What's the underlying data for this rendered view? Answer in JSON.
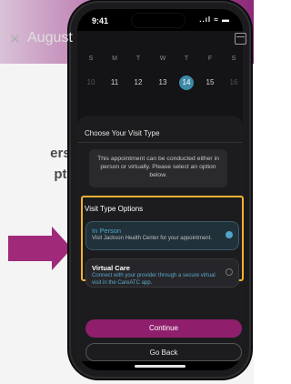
{
  "background": {
    "side_text_line1": "erson",
    "side_text_line2": "ption",
    "side_text_dot": "."
  },
  "status_bar": {
    "time": "9:41",
    "system_icons": "..ıl ≈ ▬"
  },
  "calendar": {
    "month": "August",
    "weekdays": [
      "S",
      "M",
      "T",
      "W",
      "T",
      "F",
      "S"
    ],
    "days": [
      "10",
      "11",
      "12",
      "13",
      "14",
      "15",
      "16"
    ],
    "selected_day": "14"
  },
  "sheet": {
    "title": "Choose Your Visit Type",
    "info_text": "This appointment can be conducted either in person or virtually. Please select an option below.",
    "options_heading": "Visit Type Options",
    "options": [
      {
        "title": "In Person",
        "description": "Visit Jackson Health Center for your appointment.",
        "selected": true
      },
      {
        "title": "Virtual Care",
        "description": "Connect with your provider through a secure virtual visit in the CareATC app.",
        "selected": false
      }
    ],
    "continue_label": "Continue",
    "back_label": "Go Back"
  },
  "colors": {
    "accent_magenta": "#a02a79",
    "highlight_gold": "#f2b233",
    "selected_teal": "#4fa6c9"
  }
}
